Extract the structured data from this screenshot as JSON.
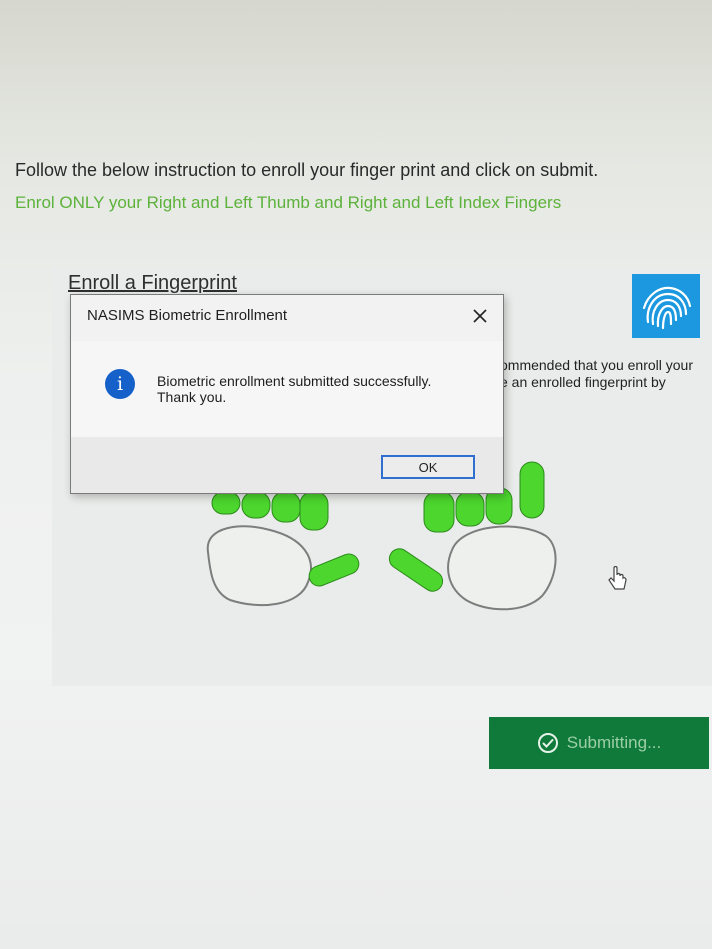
{
  "instructions": {
    "line1": "Follow the below instruction to enroll your finger print and click on submit.",
    "line2": "Enrol ONLY your Right and Left Thumb and Right and Left Index Fingers"
  },
  "enroll": {
    "title": "Enroll a Fingerprint",
    "side_text_line1": "ommended that you enroll your",
    "side_text_line2": "e an enrolled fingerprint by"
  },
  "dialog": {
    "title": "NASIMS Biometric Enrollment",
    "message_line1": "Biometric enrollment submitted successfully.",
    "message_line2": "Thank you.",
    "ok_label": "OK",
    "icon": "info-icon"
  },
  "submit": {
    "label": "Submitting...",
    "icon": "check-circle-icon"
  },
  "colors": {
    "finger_green": "#4cd62e",
    "submit_bg": "#0f7a3a",
    "instruction_green": "#5cb23a",
    "logo_blue": "#1b98df"
  }
}
